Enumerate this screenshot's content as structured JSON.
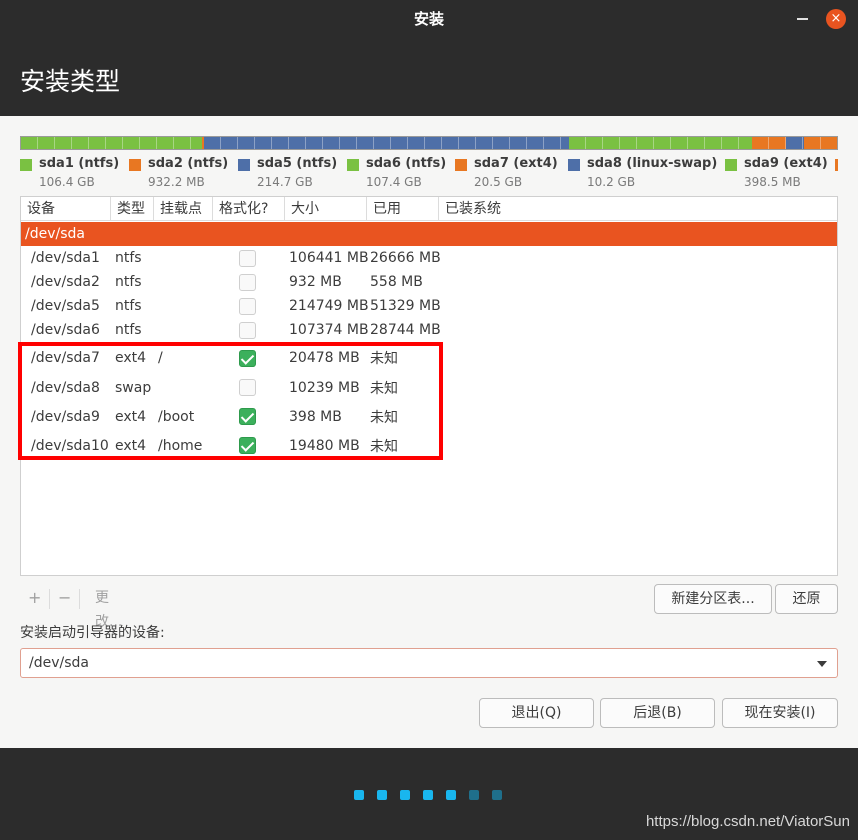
{
  "window": {
    "title": "安装",
    "close_glyph": "×"
  },
  "header": {
    "title": "安装类型"
  },
  "partition_bar": [
    {
      "color": "#7ac142",
      "size_gb": 106.4
    },
    {
      "color": "#e87722",
      "size_gb": 0.9
    },
    {
      "color": "#4e6fa8",
      "size_gb": 214.7
    },
    {
      "color": "#7ac142",
      "size_gb": 107.4
    },
    {
      "color": "#e87722",
      "size_gb": 20.5
    },
    {
      "color": "#4e6fa8",
      "size_gb": 10.2
    },
    {
      "color": "#e87722",
      "size_gb": 19.5
    }
  ],
  "legend": [
    {
      "name": "sda1 (ntfs)",
      "size": "106.4 GB",
      "color": "#7ac142"
    },
    {
      "name": "sda2 (ntfs)",
      "size": "932.2 MB",
      "color": "#e87722"
    },
    {
      "name": "sda5 (ntfs)",
      "size": "214.7 GB",
      "color": "#4e6fa8"
    },
    {
      "name": "sda6 (ntfs)",
      "size": "107.4 GB",
      "color": "#7ac142"
    },
    {
      "name": "sda7 (ext4)",
      "size": "20.5 GB",
      "color": "#e87722"
    },
    {
      "name": "sda8 (linux-swap)",
      "size": "10.2 GB",
      "color": "#4e6fa8"
    },
    {
      "name": "sda9 (ext4)",
      "size": "398.5 MB",
      "color": "#7ac142"
    },
    {
      "name": "",
      "size": "",
      "color": "#e87722"
    }
  ],
  "table": {
    "headers": [
      "设备",
      "类型",
      "挂载点",
      "格式化?",
      "大小",
      "已用",
      "已装系统"
    ],
    "disk": "/dev/sda",
    "rows": [
      {
        "device": "/dev/sda1",
        "type": "ntfs",
        "mount": "",
        "format": false,
        "size": "106441 MB",
        "used": "26666 MB",
        "system": ""
      },
      {
        "device": "/dev/sda2",
        "type": "ntfs",
        "mount": "",
        "format": false,
        "size": "932 MB",
        "used": "558 MB",
        "system": ""
      },
      {
        "device": "/dev/sda5",
        "type": "ntfs",
        "mount": "",
        "format": false,
        "size": "214749 MB",
        "used": "51329 MB",
        "system": ""
      },
      {
        "device": "/dev/sda6",
        "type": "ntfs",
        "mount": "",
        "format": false,
        "size": "107374 MB",
        "used": "28744 MB",
        "system": ""
      },
      {
        "device": "/dev/sda7",
        "type": "ext4",
        "mount": "/",
        "format": true,
        "size": "20478 MB",
        "used": "未知",
        "system": ""
      },
      {
        "device": "/dev/sda8",
        "type": "swap",
        "mount": "",
        "format": false,
        "size": "10239 MB",
        "used": "未知",
        "system": ""
      },
      {
        "device": "/dev/sda9",
        "type": "ext4",
        "mount": "/boot",
        "format": true,
        "size": "398 MB",
        "used": "未知",
        "system": ""
      },
      {
        "device": "/dev/sda10",
        "type": "ext4",
        "mount": "/home",
        "format": true,
        "size": "19480 MB",
        "used": "未知",
        "system": ""
      }
    ]
  },
  "toolbar": {
    "add": "+",
    "remove": "−",
    "change": "更改...",
    "new_table": "新建分区表...",
    "revert": "还原"
  },
  "boot": {
    "label": "安装启动引导器的设备:",
    "value": "/dev/sda"
  },
  "actions": {
    "quit": "退出(Q)",
    "back": "后退(B)",
    "install": "现在安装(I)"
  },
  "progress": {
    "total_steps": 7,
    "completed_steps": 5,
    "active_color": "#19b6ee",
    "inactive_color": "#1f6f8b"
  },
  "watermark": "https://blog.csdn.net/ViatorSun"
}
